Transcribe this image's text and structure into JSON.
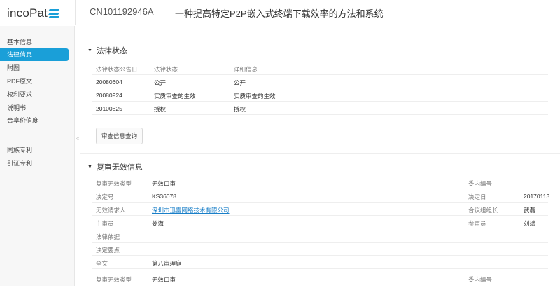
{
  "header": {
    "logo_text": "incoPat",
    "patent_no": "CN101192946A",
    "patent_title": "一种提高特定P2P嵌入式终端下载效率的方法和系统"
  },
  "sidebar": {
    "items": [
      {
        "label": "基本信息",
        "active": false
      },
      {
        "label": "法律信息",
        "active": true
      },
      {
        "label": "附图",
        "active": false
      },
      {
        "label": "PDF原文",
        "active": false
      },
      {
        "label": "权利要求",
        "active": false
      },
      {
        "label": "说明书",
        "active": false
      },
      {
        "label": "合享价值度",
        "active": false
      },
      {
        "label": "同族专利",
        "active": false
      },
      {
        "label": "引证专利",
        "active": false
      }
    ]
  },
  "legal_status": {
    "title": "法律状态",
    "headers": [
      "法律状态公告日",
      "法律状态",
      "详细信息"
    ],
    "rows": [
      [
        "20080604",
        "公开",
        "公开"
      ],
      [
        "20080924",
        "实质审查的生效",
        "实质审查的生效"
      ],
      [
        "20100825",
        "授权",
        "授权"
      ]
    ],
    "query_button": "审查信息查询"
  },
  "review": {
    "title": "复审无效信息",
    "rows": [
      {
        "l1": "复审无效类型",
        "v1": "无效口审",
        "l2": "委内编号",
        "v2": ""
      },
      {
        "l1": "决定号",
        "v1": "KS36078",
        "l2": "决定日",
        "v2": "20170113"
      },
      {
        "l1": "无效请求人",
        "v1": "深圳市迅雷网络技术有限公司",
        "l2": "合议组组长",
        "v2": "武磊",
        "link": true
      },
      {
        "l1": "主审员",
        "v1": "姜海",
        "l2": "参审员",
        "v2": "刘斌"
      },
      {
        "l1": "法律依据",
        "v1": "",
        "l2": "",
        "v2": ""
      },
      {
        "l1": "决定要点",
        "v1": "",
        "l2": "",
        "v2": ""
      },
      {
        "l1": "全文",
        "v1": "第八审理庭",
        "l2": "",
        "v2": ""
      },
      {
        "l1": "复审无效类型",
        "v1": "无效口审",
        "l2": "委内编号",
        "v2": ""
      }
    ]
  }
}
